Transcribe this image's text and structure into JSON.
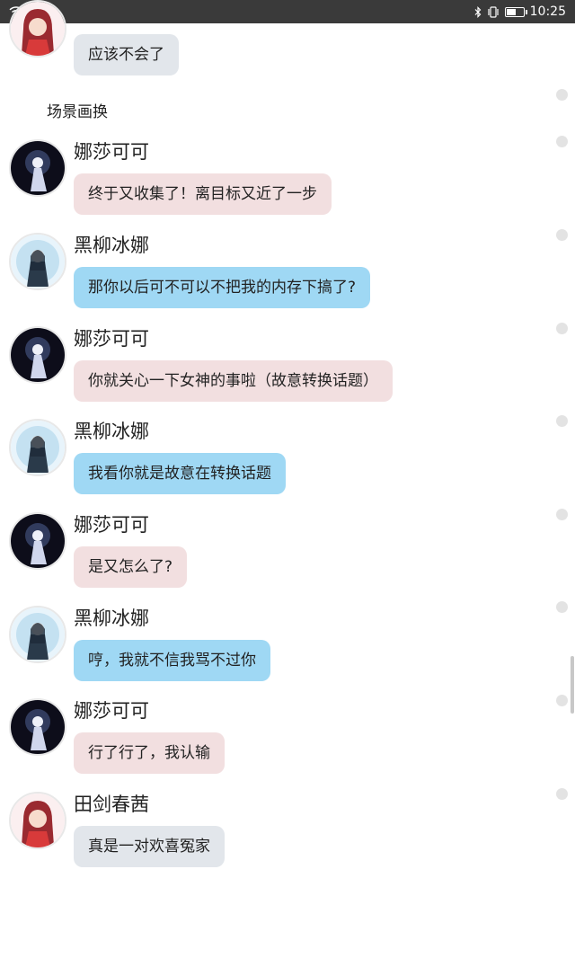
{
  "status_bar": {
    "time": "10:25",
    "battery_level": 0.55,
    "left_icons": [
      "wifi-icon",
      "red-app-icon",
      "blue-app-icon"
    ],
    "right_icons": [
      "bluetooth-icon",
      "vibrate-icon",
      "battery-icon"
    ]
  },
  "scene_label": "场景画换",
  "messages": [
    {
      "name": "",
      "text": "应该不会了",
      "style": "gray",
      "avatar": "avatar-red-hair"
    },
    {
      "name": "娜莎可可",
      "text": "终于又收集了！离目标又近了一步",
      "style": "pink",
      "avatar": "avatar-dark"
    },
    {
      "name": "黑柳冰娜",
      "text": "那你以后可不可以不把我的内存下搞了?",
      "style": "blue",
      "avatar": "avatar-light"
    },
    {
      "name": "娜莎可可",
      "text": "你就关心一下女神的事啦（故意转换话题）",
      "style": "pink",
      "avatar": "avatar-dark"
    },
    {
      "name": "黑柳冰娜",
      "text": "我看你就是故意在转换话题",
      "style": "blue",
      "avatar": "avatar-light"
    },
    {
      "name": "娜莎可可",
      "text": "是又怎么了?",
      "style": "pink",
      "avatar": "avatar-dark"
    },
    {
      "name": "黑柳冰娜",
      "text": "哼，我就不信我骂不过你",
      "style": "blue",
      "avatar": "avatar-light"
    },
    {
      "name": "娜莎可可",
      "text": "行了行了，我认输",
      "style": "pink",
      "avatar": "avatar-dark"
    },
    {
      "name": "田剑春茜",
      "text": "真是一对欢喜冤家",
      "style": "gray",
      "avatar": "avatar-red-hair"
    }
  ],
  "colors": {
    "pink_bubble": "#f2dfe0",
    "blue_bubble": "#9fd8f4",
    "gray_bubble": "#e2e6eb",
    "status_bar": "#3a3a3a"
  }
}
